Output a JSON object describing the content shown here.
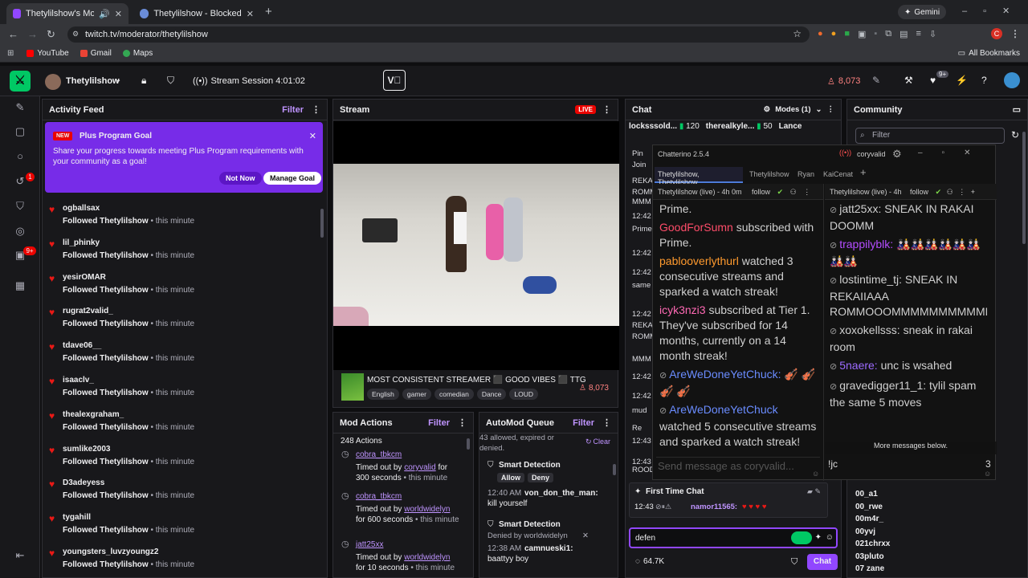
{
  "browser": {
    "tabs": [
      {
        "title": "Thetylilshow's Mod View - ",
        "active": true
      },
      {
        "title": "Thetylilshow - Blocked Terms",
        "active": false
      }
    ],
    "new_tab": "+",
    "gemini": "Gemini",
    "url": "twitch.tv/moderator/thetylilshow",
    "bookmarks": [
      "YouTube",
      "Gmail",
      "Maps"
    ],
    "all_bookmarks": "All Bookmarks",
    "profile_initial": "C"
  },
  "topnav": {
    "channel": "Thetylilshow",
    "session": "Stream Session 4:01:02",
    "viewers": "8,073",
    "notif_badge": "9+"
  },
  "rail": {
    "badge1": "1",
    "badge2": "9+"
  },
  "activity": {
    "title": "Activity Feed",
    "filter": "Filter",
    "goal": {
      "badge": "NEW",
      "title": "Plus Program Goal",
      "text": "Share your progress towards meeting Plus Program requirements with your community as a goal!",
      "not_now": "Not Now",
      "manage": "Manage Goal"
    },
    "items": [
      {
        "user": "ogballsax",
        "action": "Followed",
        "target": "Thetylilshow",
        "time": "• this minute"
      },
      {
        "user": "lil_phinky",
        "action": "Followed",
        "target": "Thetylilshow",
        "time": "• this minute"
      },
      {
        "user": "yesirOMAR",
        "action": "Followed",
        "target": "Thetylilshow",
        "time": "• this minute"
      },
      {
        "user": "rugrat2valid_",
        "action": "Followed",
        "target": "Thetylilshow",
        "time": "• this minute"
      },
      {
        "user": "tdave06__",
        "action": "Followed",
        "target": "Thetylilshow",
        "time": "• this minute"
      },
      {
        "user": "isaaclv_",
        "action": "Followed",
        "target": "Thetylilshow",
        "time": "• this minute"
      },
      {
        "user": "thealexgraham_",
        "action": "Followed",
        "target": "Thetylilshow",
        "time": "• this minute"
      },
      {
        "user": "sumlike2003",
        "action": "Followed",
        "target": "Thetylilshow",
        "time": "• this minute"
      },
      {
        "user": "D3adeyess",
        "action": "Followed",
        "target": "Thetylilshow",
        "time": "• this minute"
      },
      {
        "user": "tygahill",
        "action": "Followed",
        "target": "Thetylilshow",
        "time": "• this minute"
      },
      {
        "user": "youngsters_luvzyoungz2",
        "action": "Followed",
        "target": "Thetylilshow",
        "time": "• this minute"
      }
    ]
  },
  "stream": {
    "title": "Stream",
    "live": "LIVE",
    "stream_title": "MOST CONSISTENT STREAMER ⬛ GOOD VIBES ⬛ TTG",
    "tags": [
      "English",
      "gamer",
      "comedian",
      "Dance",
      "LOUD"
    ],
    "viewers": "8,073"
  },
  "mod_actions": {
    "title": "Mod Actions",
    "filter": "Filter",
    "count": "248 Actions",
    "items": [
      {
        "user": "cobra_tbkcm",
        "l1": "Timed out by ",
        "mod": "coryvalid",
        "l2": " for",
        "l3": "300 seconds",
        "time": " • this minute"
      },
      {
        "user": "cobra_tbkcm",
        "l1": "Timed out by ",
        "mod": "worldwidelyn",
        "l2": "",
        "l3": "for 600 seconds",
        "time": " • this minute"
      },
      {
        "user": "jatt25xx",
        "l1": "Timed out by ",
        "mod": "worldwidelyn",
        "l2": "",
        "l3": "for 10 seconds",
        "time": " • this minute"
      }
    ]
  },
  "automod": {
    "title": "AutoMod Queue",
    "filter": "Filter",
    "status": "43 allowed, expired or denied.",
    "clear": "Clear",
    "items": [
      {
        "label": "Smart Detection",
        "allow": "Allow",
        "deny": "Deny",
        "time": "12:40 AM",
        "user": "von_don_the_man:",
        "text": "kill yourself"
      },
      {
        "label": "Smart Detection",
        "denied": "Denied by worldwidelyn",
        "time": "12:38 AM",
        "user": "camnueski1:",
        "text": "baattyy boy"
      }
    ]
  },
  "twitch_chat": {
    "title": "Chat",
    "modes": "Modes (1)",
    "leaders": [
      {
        "name": "locksssold...",
        "count": "120"
      },
      {
        "name": "therealkyle...",
        "count": "50"
      },
      {
        "name": "Lance",
        "count": ""
      }
    ],
    "left_lines": [
      "Pin",
      "Join",
      "REKA",
      "ROMM",
      "MMM",
      "12:42",
      "Prime.",
      "12:42",
      "12:42",
      "same",
      "12:42",
      "REKA",
      "ROMM",
      "MMM",
      "12:42",
      "12:42",
      "mud",
      "Re",
      "12:43",
      "12:43",
      "ROOD"
    ],
    "first_time": "First Time Chat",
    "ft_time": "12:43",
    "ft_user": "namor11565:",
    "ft_hearts": "♥ ♥ ♥ ♥",
    "input": "defen",
    "points": "64.7K",
    "chat_btn": "Chat"
  },
  "chatterino": {
    "title": "Chatterino 2.5.4",
    "user": "coryvalid",
    "tabs": [
      "Thetylilshow, Thetylilshow",
      "Thetylilshow",
      "Ryan",
      "KaiCenat"
    ],
    "left_header": {
      "channel": "Thetylilshow (live) - 4h 0m",
      "follow": "follow"
    },
    "right_header": {
      "channel": "Thetylilshow (live) - 4h",
      "follow": "follow"
    },
    "left_msgs": [
      {
        "user": "",
        "text": "Prime.",
        "color": "#d0d0d0"
      },
      {
        "user": "GoodForSumn",
        "text": " subscribed with Prime.",
        "color": "#ff4d6a"
      },
      {
        "user": "pablooverlythurl",
        "text": " watched 3 consecutive streams and sparked a watch streak!",
        "color": "#ff9a2e"
      },
      {
        "user": "icyk3nzi3",
        "text": " subscribed at Tier 1. They've subscribed for 14 months, currently on a 14 month streak!",
        "color": "#ff69b4"
      },
      {
        "user": "AreWeDoneYetChuck:",
        "text": " 🎻 🎻 🎻 🎻",
        "color": "#6a8cff"
      },
      {
        "user": "AreWeDoneYetChuck",
        "text": " watched 5 consecutive streams and sparked a watch streak!",
        "color": "#6a8cff"
      }
    ],
    "right_msgs": [
      {
        "user": "jatt25xx:",
        "text": " SNEAK IN RAKAI DOOMM",
        "color": "#d0d0d0"
      },
      {
        "user": "trappilyblk:",
        "text": " 🎎🎎🎎🎎🎎🎎🎎🎎",
        "color": "#b44dff"
      },
      {
        "user": "lostintime_tj:",
        "text": " SNEAK IN REKAIIAAA ROMMOOOMMMMMMMMMMMMMMMMMMMMM\\",
        "color": "#d0d0d0"
      },
      {
        "user": "xoxokellsss:",
        "text": " sneak in rakai room",
        "color": "#d0d0d0"
      },
      {
        "user": "5naere:",
        "text": " unc is wsahed",
        "color": "#9d6bff"
      },
      {
        "user": "gravedigger11_1:",
        "text": " tylil spam the same 5 moves",
        "color": "#d0d0d0"
      }
    ],
    "more": "More messages below.",
    "left_input": "Send message as coryvalid...",
    "right_input": "!jc",
    "right_count": "3"
  },
  "community": {
    "title": "Community",
    "filter_placeholder": "Filter",
    "users": [
      "00_a1",
      "00_rwe",
      "00m4r_",
      "00yvj",
      "021chrxx",
      "03pluto",
      "07 zane"
    ]
  },
  "colors": {
    "accent": "#9147ff",
    "live": "#eb0400",
    "heart": "#e91916",
    "brand_green": "#00c864"
  }
}
